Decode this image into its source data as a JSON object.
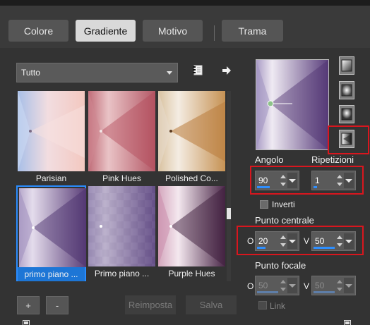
{
  "tabs": {
    "colore": "Colore",
    "gradiente": "Gradiente",
    "motivo": "Motivo",
    "trama": "Trama"
  },
  "library": {
    "category": "Tutto",
    "presets": [
      {
        "label": "Parisian"
      },
      {
        "label": "Pink Hues"
      },
      {
        "label": "Polished Co..."
      },
      {
        "label": "primo piano ..."
      },
      {
        "label": "Primo piano ..."
      },
      {
        "label": "Purple Hues"
      }
    ],
    "selected_index": 3,
    "add_label": "+",
    "remove_label": "-",
    "reset_label": "Reimposta",
    "save_label": "Salva"
  },
  "gradient": {
    "style_selected": 3,
    "angle_label": "Angolo",
    "angle_value": "90",
    "repeats_label": "Ripetizioni",
    "repeats_value": "1",
    "invert_label": "Inverti",
    "invert_checked": false,
    "center_label": "Punto centrale",
    "center_h_label": "O",
    "center_h_value": "20",
    "center_v_label": "V",
    "center_v_value": "50",
    "focal_label": "Punto focale",
    "focal_h_label": "O",
    "focal_h_value": "50",
    "focal_v_label": "V",
    "focal_v_value": "50",
    "link_label": "Link",
    "link_checked": false
  },
  "colors": {
    "accent": "#2a8cff",
    "highlight_box": "#d9161e",
    "panel": "#333333"
  }
}
